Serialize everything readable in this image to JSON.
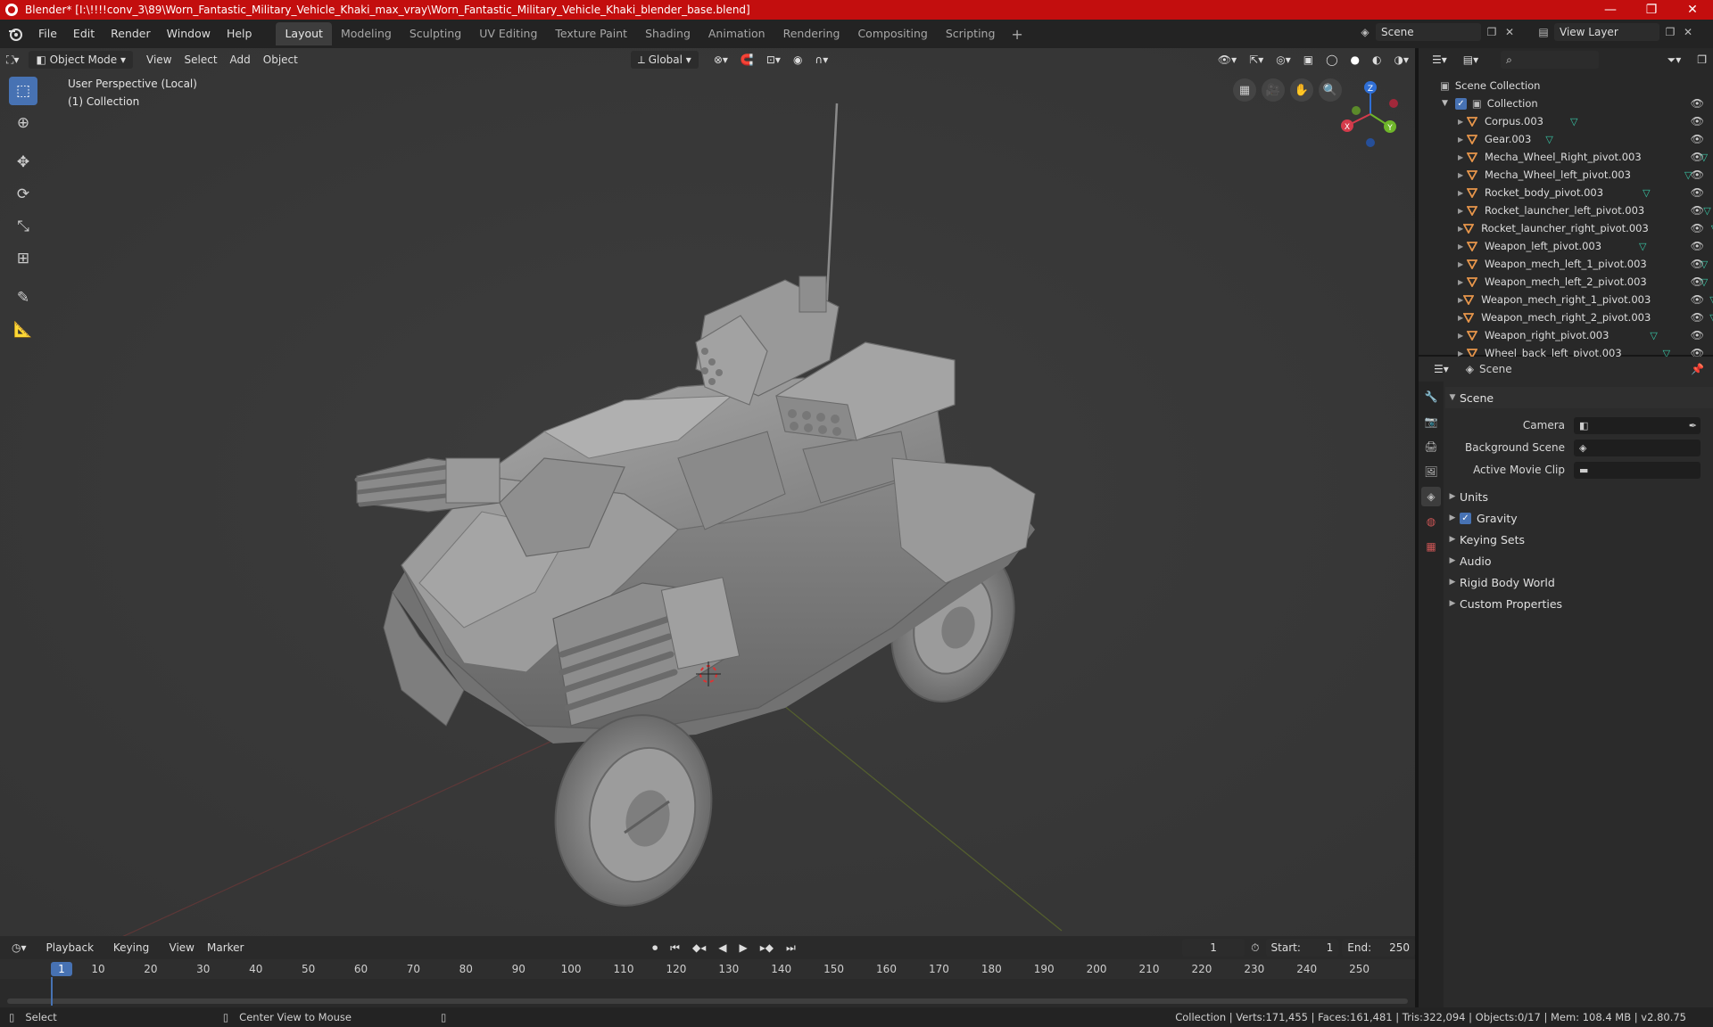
{
  "titlebar": {
    "title": "Blender* [I:\\!!!!conv_3\\89\\Worn_Fantastic_Military_Vehicle_Khaki_max_vray\\Worn_Fantastic_Military_Vehicle_Khaki_blender_base.blend]",
    "minimize": "—",
    "maximize": "❐",
    "close": "✕"
  },
  "menubar": {
    "items": [
      "File",
      "Edit",
      "Render",
      "Window",
      "Help"
    ],
    "workspaces": [
      "Layout",
      "Modeling",
      "Sculpting",
      "UV Editing",
      "Texture Paint",
      "Shading",
      "Animation",
      "Rendering",
      "Compositing",
      "Scripting"
    ],
    "active_workspace": "Layout",
    "add_tab": "+",
    "scene": "Scene",
    "view_layer": "View Layer"
  },
  "viewport": {
    "mode": "Object Mode",
    "menus": [
      "View",
      "Select",
      "Add",
      "Object"
    ],
    "transform_orientation": "Global",
    "info_line1": "User Perspective (Local)",
    "info_line2": "(1) Collection",
    "gizmo": {
      "x": "X",
      "y": "Y",
      "z": "Z"
    }
  },
  "timeline": {
    "menus": [
      "Playback",
      "Keying",
      "View",
      "Marker"
    ],
    "current_frame": "1",
    "start_label": "Start:",
    "start": "1",
    "end_label": "End:",
    "end": "250",
    "ticks": [
      "1",
      "10",
      "20",
      "30",
      "40",
      "50",
      "60",
      "70",
      "80",
      "90",
      "100",
      "110",
      "120",
      "130",
      "140",
      "150",
      "160",
      "170",
      "180",
      "190",
      "200",
      "210",
      "220",
      "230",
      "240",
      "250"
    ]
  },
  "statusbar": {
    "left_action": "Select",
    "middle_action": "Center View to Mouse",
    "stats": "Collection | Verts:171,455 | Faces:161,481 | Tris:322,094 | Objects:0/17 | Mem: 108.4 MB | v2.80.75"
  },
  "outliner": {
    "scene_collection": "Scene Collection",
    "collection": "Collection",
    "objects": [
      "Corpus.003",
      "Gear.003",
      "Mecha_Wheel_Right_pivot.003",
      "Mecha_Wheel_left_pivot.003",
      "Rocket_body_pivot.003",
      "Rocket_launcher_left_pivot.003",
      "Rocket_launcher_right_pivot.003",
      "Weapon_left_pivot.003",
      "Weapon_mech_left_1_pivot.003",
      "Weapon_mech_left_2_pivot.003",
      "Weapon_mech_right_1_pivot.003",
      "Weapon_mech_right_2_pivot.003",
      "Weapon_right_pivot.003",
      "Wheel_back_left_pivot.003"
    ]
  },
  "properties": {
    "context": "Scene",
    "panel": "Scene",
    "rows": [
      {
        "label": "Camera",
        "value": ""
      },
      {
        "label": "Background Scene",
        "value": ""
      },
      {
        "label": "Active Movie Clip",
        "value": ""
      }
    ],
    "subpanels": [
      "Units",
      "Gravity",
      "Keying Sets",
      "Audio",
      "Rigid Body World",
      "Custom Properties"
    ],
    "gravity_checked": "✓"
  },
  "colors": {
    "accent": "#4772b3",
    "titlebar": "#c30e0e",
    "viewport_bg": "#393939",
    "mesh_icon": "#e8964b",
    "data_icon": "#39c6a6"
  }
}
